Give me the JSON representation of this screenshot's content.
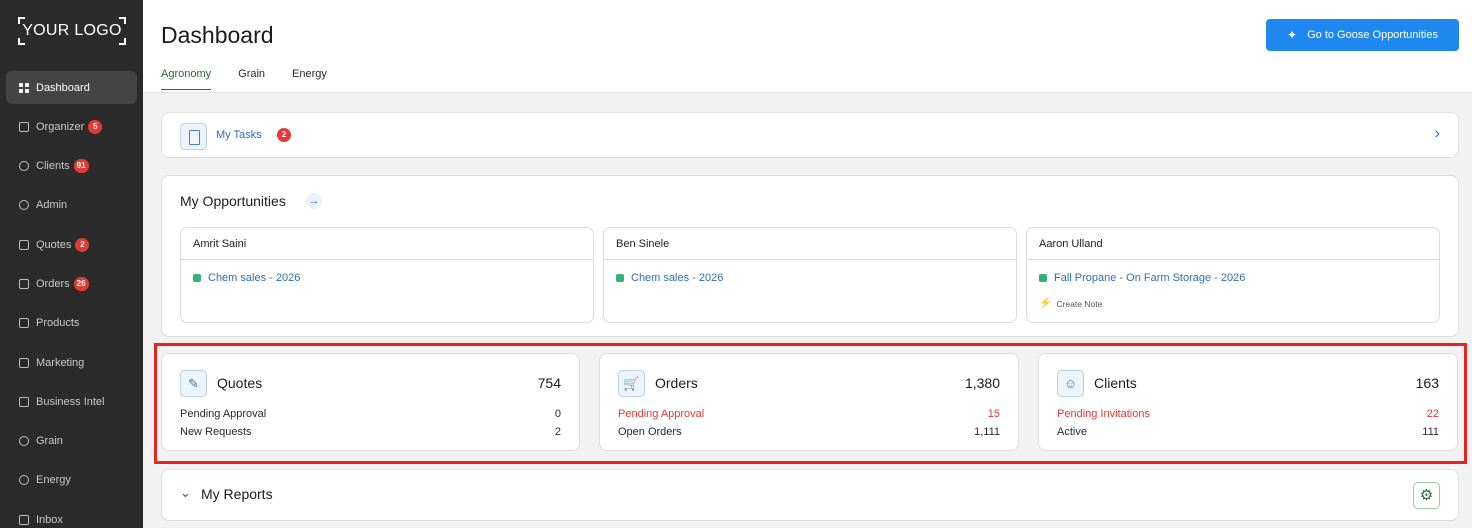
{
  "logo": {
    "text": "YOUR LOGO"
  },
  "sidebar": {
    "items": [
      {
        "label": "Dashboard",
        "icon": "grid-icon",
        "badge": ""
      },
      {
        "label": "Organizer",
        "icon": "calendar-icon",
        "badge": "5"
      },
      {
        "label": "Clients",
        "icon": "users-icon",
        "badge": "91"
      },
      {
        "label": "Admin",
        "icon": "admin-icon",
        "badge": ""
      },
      {
        "label": "Quotes",
        "icon": "document-icon",
        "badge": "2"
      },
      {
        "label": "Orders",
        "icon": "cart-icon",
        "badge": "26"
      },
      {
        "label": "Products",
        "icon": "box-icon",
        "badge": ""
      },
      {
        "label": "Marketing",
        "icon": "megaphone-icon",
        "badge": ""
      },
      {
        "label": "Business Intel",
        "icon": "chart-icon",
        "badge": ""
      },
      {
        "label": "Grain",
        "icon": "grain-icon",
        "badge": ""
      },
      {
        "label": "Energy",
        "icon": "energy-icon",
        "badge": ""
      },
      {
        "label": "Inbox",
        "icon": "inbox-icon",
        "badge": ""
      }
    ]
  },
  "header": {
    "title": "Dashboard",
    "tabs": [
      "Agronomy",
      "Grain",
      "Energy"
    ],
    "goose_button": "Go to Goose Opportunities"
  },
  "tasks": {
    "label": "My Tasks",
    "badge": "2"
  },
  "opportunities": {
    "title": "My Opportunities",
    "cards": [
      {
        "name": "Amrit Saini",
        "link": "Chem sales - 2026",
        "note": ""
      },
      {
        "name": "Ben Sinele",
        "link": "Chem sales - 2026",
        "note": ""
      },
      {
        "name": "Aaron Ulland",
        "link": "Fall Propane - On Farm Storage - 2026",
        "note": "Create Note"
      }
    ]
  },
  "stats": {
    "quotes": {
      "title": "Quotes",
      "total": "754",
      "row1_label": "Pending Approval",
      "row1_value": "0",
      "row2_label": "New Requests",
      "row2_value": "2"
    },
    "orders": {
      "title": "Orders",
      "total": "1,380",
      "row1_label": "Pending Approval",
      "row1_value": "15",
      "row2_label": "Open Orders",
      "row2_value": "1,111"
    },
    "clients": {
      "title": "Clients",
      "total": "163",
      "row1_label": "Pending Invitations",
      "row1_value": "22",
      "row2_label": "Active",
      "row2_value": "111"
    }
  },
  "reports": {
    "title": "My Reports"
  },
  "colors": {
    "accent": "#1e88f0",
    "brand_green": "#1f6b3a",
    "alert_red": "#e53935",
    "sidebar_bg": "#2b2b2b"
  }
}
